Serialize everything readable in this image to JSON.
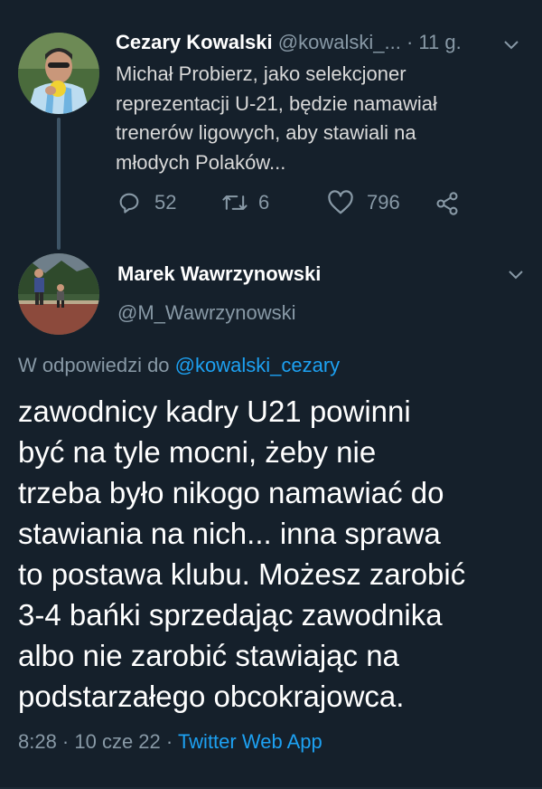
{
  "tweet1": {
    "author_name": "Cezary Kowalski",
    "author_handle": "@kowalski_...",
    "dot": "·",
    "time": "11 g.",
    "text_lines": [
      "Michał Probierz, jako selekcjoner",
      "reprezentacji U-21, będzie namawiał",
      "trenerów ligowych, aby stawiali na",
      "młodych Polaków..."
    ],
    "replies": "52",
    "retweets": "6",
    "likes": "796"
  },
  "tweet2": {
    "author_name": "Marek Wawrzynowski",
    "author_handle": "@M_Wawrzynowski",
    "reply_prefix": "W odpowiedzi do",
    "reply_to": "@kowalski_cezary",
    "text_lines": [
      "zawodnicy kadry U21 powinni",
      "być na tyle mocni, żeby nie",
      "trzeba było nikogo namawiać do",
      "stawiania na nich... inna sprawa",
      "to postawa klubu. Możesz zarobić",
      "3-4 bańki sprzedając zawodnika",
      "albo nie zarobić stawiając na",
      "podstarzałego obcokrajowca."
    ],
    "timestamp": "8:28 · 10 cze 22 ·",
    "source": "Twitter Web App"
  },
  "colors": {
    "background": "#15202b",
    "text": "#d9d9d9",
    "muted": "#8899a6",
    "link": "#1da1f2"
  },
  "icons": [
    "chevron-down-icon",
    "reply-icon",
    "retweet-icon",
    "like-icon",
    "share-icon"
  ]
}
